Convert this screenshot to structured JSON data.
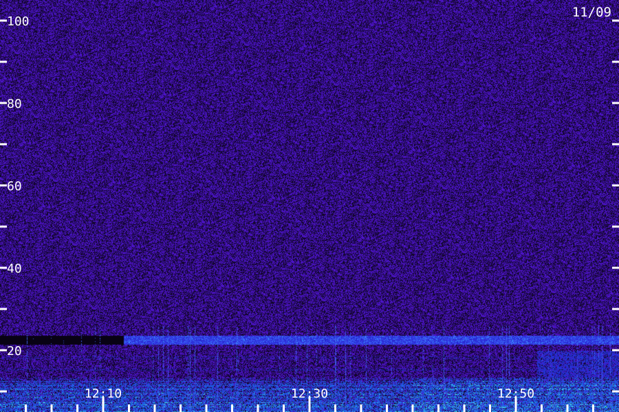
{
  "date_label": "11/09",
  "chart_data": {
    "type": "heatmap",
    "title": "",
    "xlabel": "",
    "ylabel": "",
    "ylim": [
      0,
      100
    ],
    "y_major_ticks": [
      20,
      40,
      60,
      80,
      100
    ],
    "y_minor_ticks": [
      10,
      30,
      50,
      70,
      90
    ],
    "y_tick_labels": [
      "20",
      "40",
      "60",
      "80",
      "100"
    ],
    "x_range": [
      "12:00",
      "13:00"
    ],
    "x_tick_labels": [
      {
        "time": "12:10",
        "label": "12:10"
      },
      {
        "time": "12:30",
        "label": "12:30"
      },
      {
        "time": "12:50",
        "label": "12:50"
      }
    ],
    "x_minor_tick_minutes": [
      2.5,
      5,
      7.5,
      12.5,
      15,
      17.5,
      20,
      22.5,
      25,
      27.5,
      32.5,
      35,
      37.5,
      40,
      42.5,
      45,
      47.5,
      52.5,
      55,
      57.5
    ],
    "colors": {
      "background": "#2a0a55",
      "noise": "#4b14a0",
      "moderate": "#2020e0",
      "strong": "#3a8cff",
      "peak": "#40f0e0"
    },
    "features": [
      {
        "name": "noise floor",
        "y_range": [
          30,
          100
        ],
        "intensity": "low"
      },
      {
        "name": "band",
        "y_range": [
          21.5,
          23.5
        ],
        "t_range": [
          "12:12",
          "13:00"
        ],
        "intensity": "moderate"
      },
      {
        "name": "dark band",
        "y_range": [
          21.5,
          23.5
        ],
        "t_range": [
          "12:00",
          "12:12"
        ],
        "intensity": "none"
      },
      {
        "name": "low-frequency activity",
        "y_range": [
          0,
          13
        ],
        "t_range": [
          "12:00",
          "13:00"
        ],
        "intensity": "strong"
      }
    ]
  }
}
